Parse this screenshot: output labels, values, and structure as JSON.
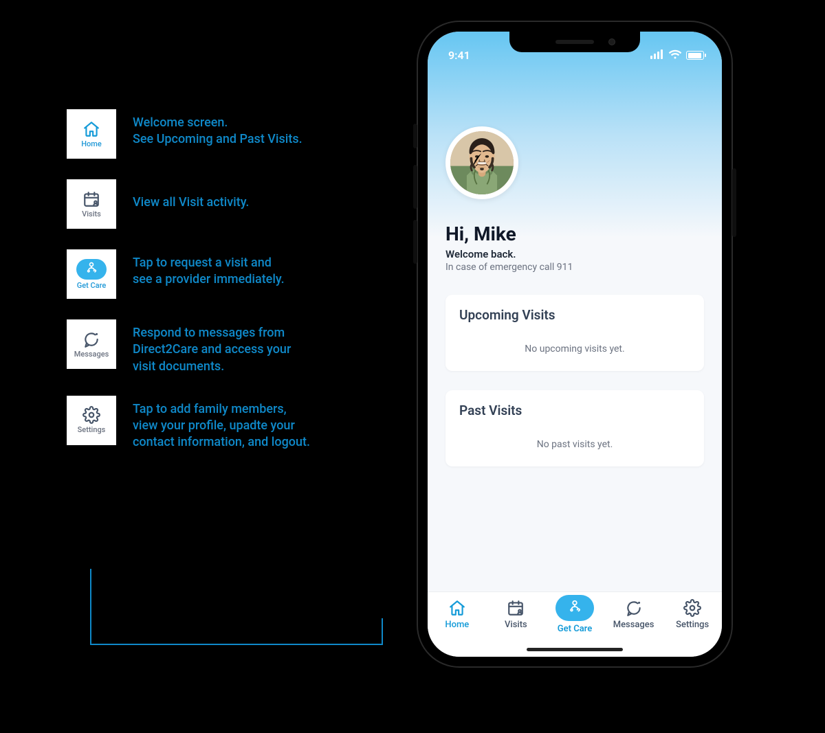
{
  "status": {
    "time": "9:41"
  },
  "greeting": {
    "title": "Hi, Mike",
    "subtitle": "Welcome back.",
    "note": "In case of emergency call 911"
  },
  "cards": {
    "upcoming": {
      "title": "Upcoming Visits",
      "empty": "No upcoming visits yet."
    },
    "past": {
      "title": "Past Visits",
      "empty": "No past visits yet."
    }
  },
  "nav": {
    "home": {
      "label": "Home"
    },
    "visits": {
      "label": "Visits"
    },
    "getcare": {
      "label": "Get Care"
    },
    "messages": {
      "label": "Messages"
    },
    "settings": {
      "label": "Settings"
    }
  },
  "legend": {
    "home": {
      "label": "Home",
      "desc": "Welcome screen.\nSee Upcoming and Past Visits."
    },
    "visits": {
      "label": "Visits",
      "desc": "View all Visit activity."
    },
    "getcare": {
      "label": "Get Care",
      "desc": "Tap to request a visit and\nsee a provider immediately."
    },
    "messages": {
      "label": "Messages",
      "desc": "Respond to messages from\nDirect2Care and access your\nvisit documents."
    },
    "settings": {
      "label": "Settings",
      "desc": "Tap to add family members,\nview your profile, upadte your\ncontact information, and logout."
    }
  },
  "colors": {
    "accent": "#159bd8",
    "accentFill": "#35b3ec",
    "legendText": "#0f89c9"
  }
}
